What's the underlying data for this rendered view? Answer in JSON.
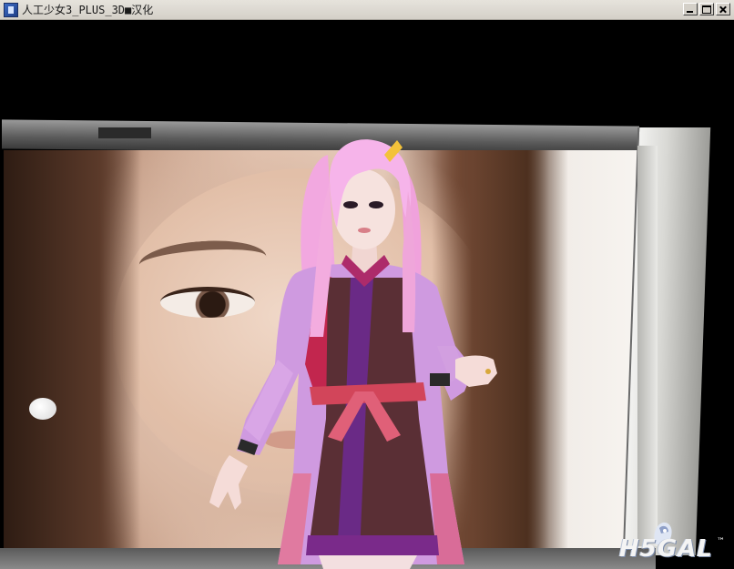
{
  "window": {
    "title": "人工少女3_PLUS_3D■汉化",
    "icon": "app-icon",
    "controls": {
      "minimize_icon": "minimize-icon",
      "maximize_icon": "maximize-icon",
      "close_icon": "close-icon"
    }
  },
  "scene": {
    "background": "photo-billboard",
    "character": "pink-haired-3d-girl"
  },
  "watermark": {
    "brand_text": "H5GAL",
    "trademark": "™"
  }
}
